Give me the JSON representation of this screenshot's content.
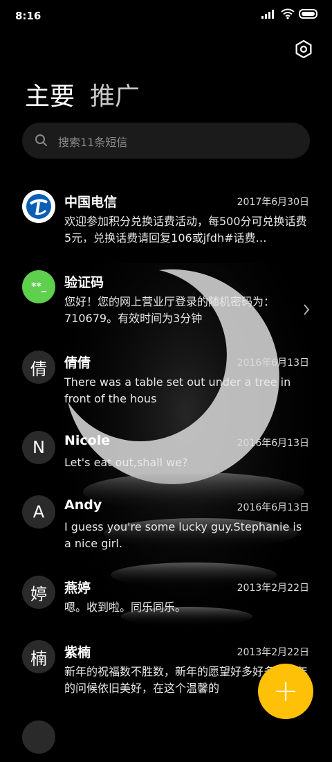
{
  "status": {
    "time": "8:16"
  },
  "tabs": {
    "primary": "主要",
    "secondary": "推广"
  },
  "search": {
    "placeholder": "搜索11条短信"
  },
  "messages": [
    {
      "name": "中国电信",
      "date": "2017年6月30日",
      "preview": "欢迎参加积分兑换话费活动，每500分可兑换话费5元，兑换话费请回复106或jfdh#话费…",
      "avatar": "telecom-logo"
    },
    {
      "name": "验证码",
      "date": "",
      "preview": "您好！您的网上营业厅登录的随机密码为：710679。有效时间为3分钟",
      "avatar": "**_"
    },
    {
      "name": "倩倩",
      "date": "2016年6月13日",
      "preview": "There was a table set out under a tree in front of the hous",
      "avatar": "倩"
    },
    {
      "name": "Nicole",
      "date": "2016年6月13日",
      "preview": "Let's eat out,shall we?",
      "avatar": "N"
    },
    {
      "name": "Andy",
      "date": "2016年6月13日",
      "preview": "I guess you're some lucky guy.Stephanie is a nice girl.",
      "avatar": "A"
    },
    {
      "name": "燕婷",
      "date": "2013年2月22日",
      "preview": "嗯。收到啦。同乐同乐。",
      "avatar": "婷"
    },
    {
      "name": "紫楠",
      "date": "2013年2月22日",
      "preview": "新年的祝福数不胜数，新年的愿望好多好多，新年的问候依旧美好，在这个温馨的",
      "avatar": "楠"
    }
  ],
  "colors": {
    "accent": "#ffc107",
    "green": "#5fcf4e",
    "background": "#000000"
  }
}
